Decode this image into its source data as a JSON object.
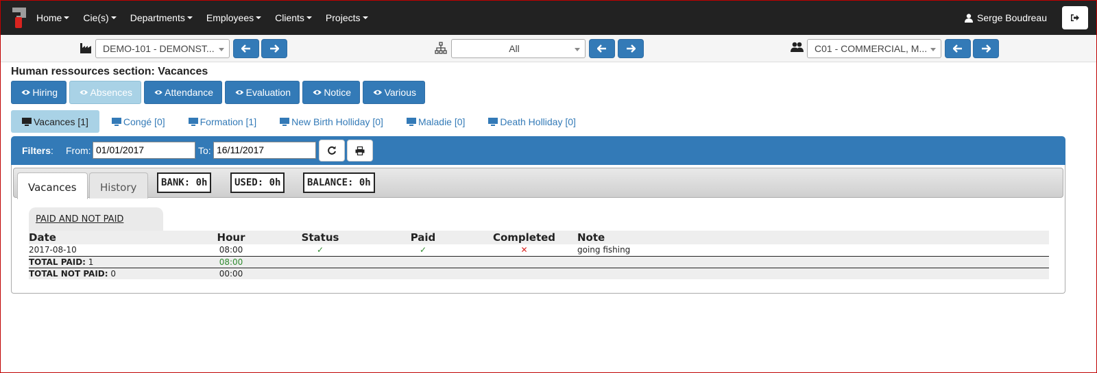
{
  "nav": {
    "items": [
      "Home",
      "Cie(s)",
      "Departments",
      "Employees",
      "Clients",
      "Projects"
    ],
    "user": "Serge Boudreau"
  },
  "selectors": {
    "company": "DEMO-101 - DEMONST...",
    "department": "All",
    "employee": "C01 - COMMERCIAL, M..."
  },
  "page_title": "Human ressources section: Vacances",
  "section_buttons": [
    "Hiring",
    "Absences",
    "Attendance",
    "Evaluation",
    "Notice",
    "Various"
  ],
  "active_section": "Absences",
  "pills": [
    "Vacances [1]",
    "Congé [0]",
    "Formation [1]",
    "New Birth Holliday [0]",
    "Maladie [0]",
    "Death Holliday [0]"
  ],
  "filters": {
    "title": "Filters",
    "from_label": "From:",
    "from_value": "01/01/2017",
    "to_label": "To:",
    "to_value": "16/11/2017"
  },
  "tabs": {
    "vacances": "Vacances",
    "history": "History"
  },
  "stats": {
    "bank": "BANK: 0h",
    "used": "USED: 0h",
    "balance": "BALANCE: 0h"
  },
  "subtab": "PAID AND NOT PAID",
  "table": {
    "headers": [
      "Date",
      "Hour",
      "Status",
      "Paid",
      "Completed",
      "Note"
    ],
    "rows": [
      {
        "date": "2017-08-10",
        "hour": "08:00",
        "status": "✓",
        "paid": "✓",
        "completed": "✕",
        "note": "going fishing"
      }
    ],
    "total_paid_label": "TOTAL PAID:",
    "total_paid_count": "1",
    "total_paid_hours": "08:00",
    "total_not_paid_label": "TOTAL NOT PAID:",
    "total_not_paid_count": "0",
    "total_not_paid_hours": "00:00"
  },
  "colors": {
    "primary": "#337ab7",
    "active": "#a9d2e6",
    "navbar": "#222222"
  }
}
